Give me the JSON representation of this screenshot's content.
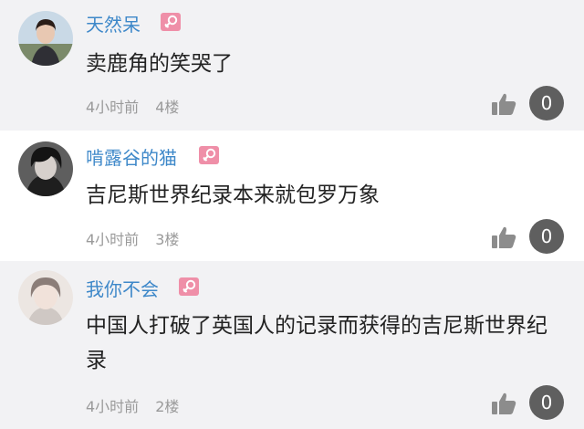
{
  "comments": [
    {
      "username": "天然呆",
      "gender": "female",
      "text": "卖鹿角的笑哭了",
      "time": "4小时前",
      "floor": "4楼",
      "likes": "0"
    },
    {
      "username": "啃露谷的猫",
      "gender": "female",
      "text": "吉尼斯世界纪录本来就包罗万象",
      "time": "4小时前",
      "floor": "3楼",
      "likes": "0"
    },
    {
      "username": "我你不会",
      "gender": "female",
      "text": "中国人打破了英国人的记录而获得的吉尼斯世界纪录",
      "time": "4小时前",
      "floor": "2楼",
      "likes": "0"
    }
  ],
  "colors": {
    "username": "#3e88c9",
    "female_badge": "#ef8fa8",
    "like_count_bg": "#5f5f5f",
    "meta_text": "#9a9a9a"
  },
  "icons": {
    "female": "female-symbol-icon",
    "like": "thumbs-up-icon"
  }
}
